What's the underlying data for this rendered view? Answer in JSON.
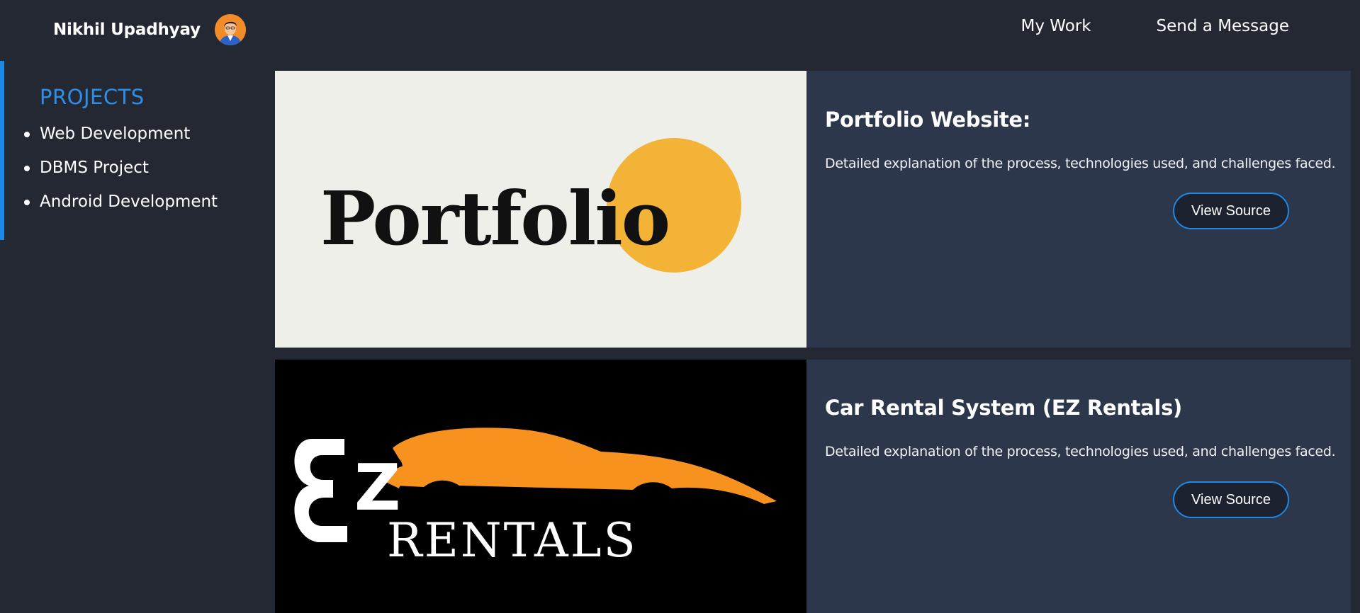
{
  "header": {
    "brand_name": "Nikhil Upadhyay",
    "avatar_icon": "person-avatar-icon",
    "nav": [
      {
        "label": "My Work"
      },
      {
        "label": "Send a Message"
      }
    ]
  },
  "sidebar": {
    "title": "PROJECTS",
    "items": [
      {
        "label": "Web Development"
      },
      {
        "label": "DBMS Project"
      },
      {
        "label": "Android Development"
      }
    ]
  },
  "projects": [
    {
      "image_text": "Portfolio",
      "title": "Portfolio Website:",
      "description": "Detailed explanation of the process, technologies used, and challenges faced.",
      "button_label": "View Source"
    },
    {
      "image_text_top": "Z",
      "image_text_bottom": "RENTALS",
      "title": "Car Rental System (EZ Rentals)",
      "description": "Detailed explanation of the process, technologies used, and challenges faced.",
      "button_label": "View Source"
    }
  ],
  "colors": {
    "background": "#232833",
    "card": "#2d374b",
    "accent": "#1e88e5",
    "portfolio_circle": "#f2b336",
    "car_orange": "#f7921e"
  }
}
